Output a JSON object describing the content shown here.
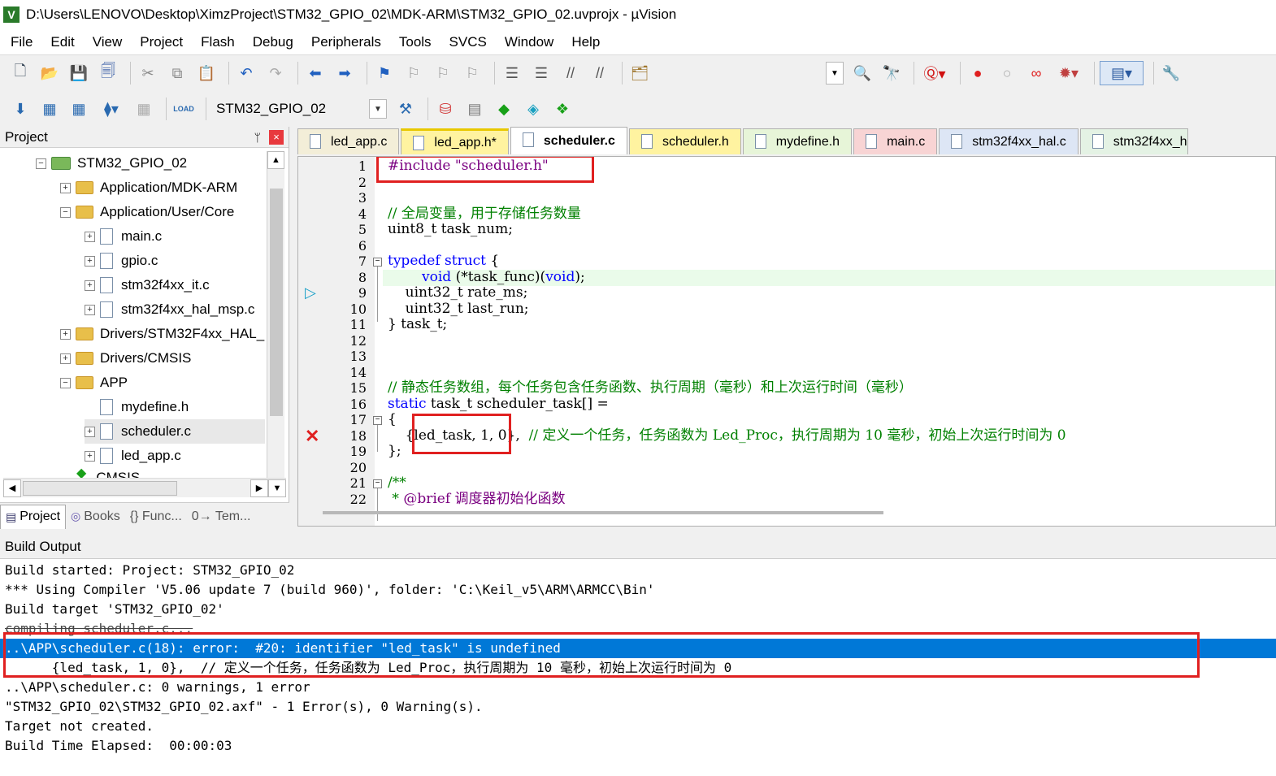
{
  "window": {
    "title": "D:\\Users\\LENOVO\\Desktop\\XimzProject\\STM32_GPIO_02\\MDK-ARM\\STM32_GPIO_02.uvprojx - µVision",
    "icon_letter": "V"
  },
  "menu": [
    "File",
    "Edit",
    "View",
    "Project",
    "Flash",
    "Debug",
    "Peripherals",
    "Tools",
    "SVCS",
    "Window",
    "Help"
  ],
  "toolbar": {
    "target_name": "STM32_GPIO_02",
    "load_label": "LOAD"
  },
  "project_panel": {
    "title": "Project",
    "close_label": "×",
    "pin_label": "ᛘ",
    "tree": [
      {
        "label": "STM32_GPIO_02",
        "type": "root",
        "expander": "−"
      },
      {
        "label": "Application/MDK-ARM",
        "type": "folder",
        "expander": "+"
      },
      {
        "label": "Application/User/Core",
        "type": "folder-open",
        "expander": "−"
      },
      {
        "label": "main.c",
        "type": "file",
        "expander": "+"
      },
      {
        "label": "gpio.c",
        "type": "file",
        "expander": "+"
      },
      {
        "label": "stm32f4xx_it.c",
        "type": "file",
        "expander": "+"
      },
      {
        "label": "stm32f4xx_hal_msp.c",
        "type": "file",
        "expander": "+"
      },
      {
        "label": "Drivers/STM32F4xx_HAL_",
        "type": "folder",
        "expander": "+"
      },
      {
        "label": "Drivers/CMSIS",
        "type": "folder",
        "expander": "+"
      },
      {
        "label": "APP",
        "type": "folder-open",
        "expander": "−"
      },
      {
        "label": "mydefine.h",
        "type": "file",
        "expander": ""
      },
      {
        "label": "scheduler.c",
        "type": "file",
        "expander": "+"
      },
      {
        "label": "led_app.c",
        "type": "file",
        "expander": "+"
      },
      {
        "label": "CMSIS",
        "type": "component",
        "expander": ""
      }
    ],
    "bottom_tabs": [
      "Project",
      "Books",
      "{} Func...",
      "0→ Tem..."
    ]
  },
  "editor": {
    "tabs": [
      {
        "label": "led_app.c",
        "color": "#f3eed8"
      },
      {
        "label": "led_app.h*",
        "color": "#fff3a0"
      },
      {
        "label": "scheduler.c",
        "color": "#ffffff"
      },
      {
        "label": "scheduler.h",
        "color": "#fff3a0"
      },
      {
        "label": "mydefine.h",
        "color": "#e7f5d8"
      },
      {
        "label": "main.c",
        "color": "#f8d4d4"
      },
      {
        "label": "stm32f4xx_hal.c",
        "color": "#dde6f5"
      },
      {
        "label": "stm32f4xx_h",
        "color": "#e4f2e4"
      }
    ],
    "line_numbers": [
      "1",
      "2",
      "3",
      "4",
      "5",
      "6",
      "7",
      "8",
      "9",
      "10",
      "11",
      "12",
      "13",
      "14",
      "15",
      "16",
      "17",
      "18",
      "19",
      "20",
      "21",
      "22"
    ],
    "code": {
      "l1_pp": "#include ",
      "l1_str": "\"scheduler.h\"",
      "l4": "// 全局变量，用于存储任务数量",
      "l5": "uint8_t task_num;",
      "l7_kw": "typedef struct",
      "l7_rest": " {",
      "l8_kw1": "void",
      "l8_mid": " (*task_func)(",
      "l8_kw2": "void",
      "l8_end": ");",
      "l9": "    uint32_t rate_ms;",
      "l10": "    uint32_t last_run;",
      "l11": "} task_t;",
      "l15": "// 静态任务数组，每个任务包含任务函数、执行周期（毫秒）和上次运行时间（毫秒）",
      "l16_kw": "static",
      "l16_rest": " task_t scheduler_task[] =",
      "l17": "{",
      "l18_code": "    {led_task, 1, 0},  ",
      "l18_cmt": "// 定义一个任务，任务函数为 Led_Proc，执行周期为 10 毫秒，初始上次运行时间为 0",
      "l19": "};",
      "l21": "/**",
      "l22_a": " * ",
      "l22_b": "@brief 调度器初始化函数"
    }
  },
  "build_output": {
    "title": "Build Output",
    "lines": [
      "Build started: Project: STM32_GPIO_02",
      "*** Using Compiler 'V5.06 update 7 (build 960)', folder: 'C:\\Keil_v5\\ARM\\ARMCC\\Bin'",
      "Build target 'STM32_GPIO_02'",
      "compiling scheduler.c...",
      "..\\APP\\scheduler.c(18): error:  #20: identifier \"led_task\" is undefined",
      "      {led_task, 1, 0},  // 定义一个任务，任务函数为 Led_Proc，执行周期为 10 毫秒，初始上次运行时间为 0",
      "..\\APP\\scheduler.c: 0 warnings, 1 error",
      "\"STM32_GPIO_02\\STM32_GPIO_02.axf\" - 1 Error(s), 0 Warning(s).",
      "Target not created.",
      "Build Time Elapsed:  00:00:03"
    ]
  },
  "colors": {
    "selection": "#0078d7",
    "annotation_red": "#e02020",
    "keyword": "#0000ff",
    "comment": "#008000"
  }
}
